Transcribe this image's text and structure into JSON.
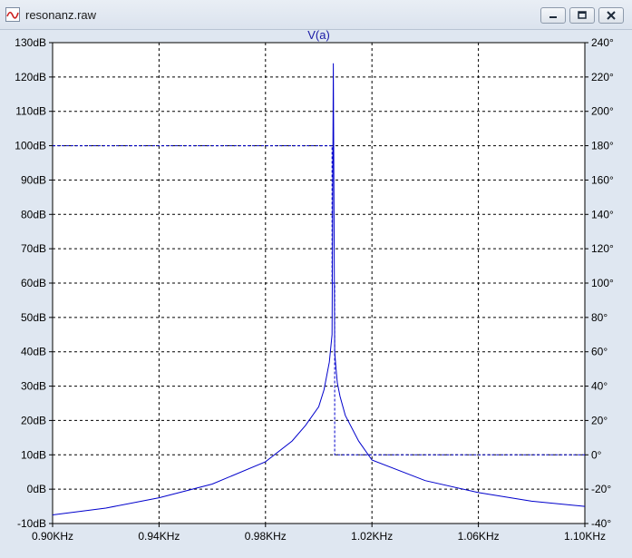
{
  "window": {
    "title": "resonanz.raw",
    "buttons": {
      "minimize": "minimize",
      "maximize": "maximize",
      "close": "close"
    }
  },
  "chart_data": {
    "type": "line",
    "title": "V(a)",
    "xlim": [
      0.9,
      1.1
    ],
    "ylim_left": [
      -10,
      130
    ],
    "ylim_right": [
      -40,
      240
    ],
    "x_ticks": [
      "0.90KHz",
      "0.94KHz",
      "0.98KHz",
      "1.02KHz",
      "1.06KHz",
      "1.10KHz"
    ],
    "x_tick_values": [
      0.9,
      0.94,
      0.98,
      1.02,
      1.06,
      1.1
    ],
    "y_left_ticks": [
      "-10dB",
      "0dB",
      "10dB",
      "20dB",
      "30dB",
      "40dB",
      "50dB",
      "60dB",
      "70dB",
      "80dB",
      "90dB",
      "100dB",
      "110dB",
      "120dB",
      "130dB"
    ],
    "y_left_values": [
      -10,
      0,
      10,
      20,
      30,
      40,
      50,
      60,
      70,
      80,
      90,
      100,
      110,
      120,
      130
    ],
    "y_right_ticks": [
      "-40°",
      "-20°",
      "0°",
      "20°",
      "40°",
      "60°",
      "80°",
      "100°",
      "120°",
      "140°",
      "160°",
      "180°",
      "200°",
      "220°",
      "240°"
    ],
    "y_right_values": [
      -40,
      -20,
      0,
      20,
      40,
      60,
      80,
      100,
      120,
      140,
      160,
      180,
      200,
      220,
      240
    ],
    "grid": true,
    "colors": {
      "trace": "#0000cc",
      "grid": "#000000",
      "title": "#1a1aa6",
      "plot_bg": "#ffffff"
    },
    "series": [
      {
        "axis": "left",
        "style": "solid",
        "x": [
          0.9,
          0.92,
          0.94,
          0.96,
          0.98,
          0.99,
          0.995,
          1.0,
          1.002,
          1.003,
          1.004,
          1.005,
          1.0055,
          1.006,
          1.0065,
          1.007,
          1.008,
          1.01,
          1.015,
          1.02,
          1.04,
          1.06,
          1.08,
          1.1
        ],
        "y": [
          -7.5,
          -5.5,
          -2.5,
          1.5,
          8,
          14,
          18.5,
          24,
          29,
          33,
          37,
          45,
          124,
          40,
          35,
          31,
          27,
          21.5,
          14,
          8.5,
          2.5,
          -1,
          -3.5,
          -5
        ]
      },
      {
        "axis": "right",
        "style": "dashed",
        "x": [
          0.9,
          1.005,
          1.005,
          1.006,
          1.006,
          1.1
        ],
        "y": [
          180,
          180,
          100,
          100,
          0,
          0
        ]
      }
    ]
  }
}
